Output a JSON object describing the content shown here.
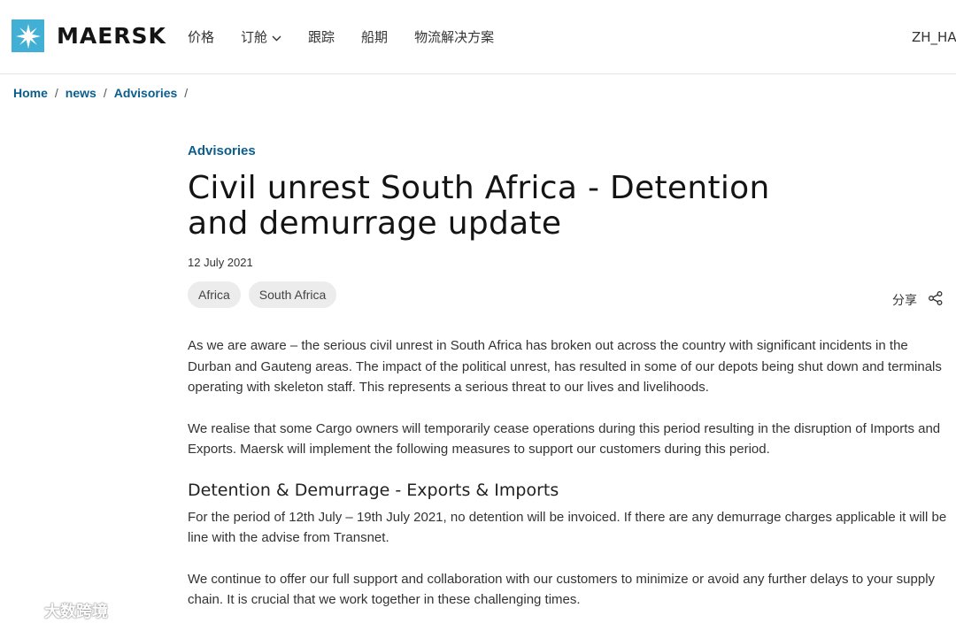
{
  "header": {
    "logo_text": "MAERSK",
    "nav": [
      "价格",
      "订舱",
      "跟踪",
      "船期",
      "物流解决方案"
    ],
    "language": "ZH_HANS"
  },
  "breadcrumb": [
    "Home",
    "news",
    "Advisories"
  ],
  "article": {
    "category": "Advisories",
    "title": "Civil unrest South Africa - Detention and demurrage update",
    "date": "12 July 2021",
    "tags": [
      "Africa",
      "South Africa"
    ],
    "share_label": "分享",
    "paragraphs": [
      "As we are aware – the serious civil unrest in South Africa has broken out across the country with significant incidents in the Durban and Gauteng areas. The impact of the political unrest, has resulted in some of our depots being shut down and terminals operating with skeleton staff. This represents a serious threat to our lives and livelihoods.",
      "We realise that some Cargo owners will temporarily cease operations during this period resulting in the disruption of Imports and Exports. Maersk will implement the following measures to support our customers during this period."
    ],
    "subheading": "Detention & Demurrage - Exports & Imports",
    "paragraphs_2": [
      "For the period of 12th July – 19th July 2021, no detention will be invoiced. If there are any demurrage charges applicable it will be line with the advise from Transnet.",
      "We continue to offer our full support and collaboration with our customers to minimize or avoid any further delays to your supply chain. It is crucial that we work together in these challenging times."
    ]
  },
  "watermark": "大数跨境",
  "colors": {
    "brand": "#42b0d5",
    "link": "#0b5e8c"
  }
}
